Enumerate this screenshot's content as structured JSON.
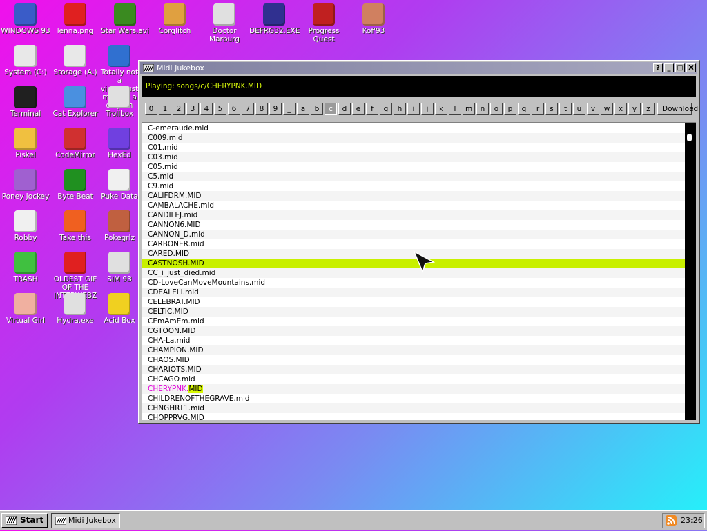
{
  "desktop": {
    "icons": [
      {
        "label": "WINDOWS 93",
        "icon": "computer-icon"
      },
      {
        "label": "lenna.png",
        "icon": "image-file-icon"
      },
      {
        "label": "Star Wars.avi",
        "icon": "yoda-icon"
      },
      {
        "label": "Corglitch",
        "icon": "corgi-icon"
      },
      {
        "label": "Doctor Marburg",
        "icon": "doctor-icon"
      },
      {
        "label": "DEFRG32.EXE",
        "icon": "defrag-icon"
      },
      {
        "label": "Progress Quest",
        "icon": "crossed-swords-icon"
      },
      {
        "label": "Kof'93",
        "icon": "fighter-icon"
      },
      {
        "label": "System (C:)",
        "icon": "drive-icon"
      },
      {
        "label": "Storage (A:)",
        "icon": "floppy-drive-icon"
      },
      {
        "label": "Totally not a virus.Trust me...im a dolphin",
        "icon": "dolphin-icon"
      },
      {
        "label": "Terminal",
        "icon": "terminal-icon"
      },
      {
        "label": "Cat Explorer",
        "icon": "cat-globe-icon"
      },
      {
        "label": "Trollbox",
        "icon": "trollbox-icon"
      },
      {
        "label": "Piskel",
        "icon": "palette-icon"
      },
      {
        "label": "CodeMirror",
        "icon": "codemirror-icon"
      },
      {
        "label": "HexEd",
        "icon": "hex-cube-icon"
      },
      {
        "label": "Poney Jockey",
        "icon": "pony-icon"
      },
      {
        "label": "Byte Beat",
        "icon": "bytebeat-icon"
      },
      {
        "label": "Puke Data",
        "icon": "pd-icon"
      },
      {
        "label": "Robby",
        "icon": "stick-figure-icon"
      },
      {
        "label": "Take this",
        "icon": "pixel-man-icon"
      },
      {
        "label": "Pokegrlz",
        "icon": "pokeball-icon"
      },
      {
        "label": "TRASH",
        "icon": "recycle-bin-icon"
      },
      {
        "label": "OLDEST GIF OF THE INTERWEBZ",
        "icon": "gif-file-icon"
      },
      {
        "label": "SIM 93",
        "icon": "sim-icon"
      },
      {
        "label": "Virtual Girl",
        "icon": "face-icon"
      },
      {
        "label": "Hydra.exe",
        "icon": "hydra-icon"
      },
      {
        "label": "Acid Box",
        "icon": "smiley-icon"
      }
    ]
  },
  "window": {
    "title": "Midi Jukebox",
    "status": "Playing: songs/c/CHERYPNK.MID",
    "letters": [
      "0",
      "1",
      "2",
      "3",
      "4",
      "5",
      "6",
      "7",
      "8",
      "9",
      "_",
      "a",
      "b",
      "c",
      "d",
      "e",
      "f",
      "g",
      "h",
      "i",
      "j",
      "k",
      "l",
      "m",
      "n",
      "o",
      "p",
      "q",
      "r",
      "s",
      "t",
      "u",
      "v",
      "w",
      "x",
      "y",
      "z"
    ],
    "active_letter": "c",
    "download_label": "Download",
    "buttons": {
      "help": "?",
      "minimize": "_",
      "maximize": "□",
      "close": "X"
    },
    "files": [
      "C-emeraude.mid",
      "C009.mid",
      "C01.mid",
      "C03.mid",
      "C05.mid",
      "C5.mid",
      "C9.mid",
      "CALIFDRM.MID",
      "CAMBALACHE.mid",
      "CANDILEJ.mid",
      "CANNON6.MID",
      "CANNON_D.mid",
      "CARBONER.mid",
      "CARED.MID",
      "CASTNOSH.MID",
      "CC_i_just_died.mid",
      "CD-LoveCanMoveMountains.mid",
      "CDEALELI.mid",
      "CELEBRAT.MID",
      "CELTIC.MID",
      "CEmAmEm.mid",
      "CGTOON.MID",
      "CHA-La.mid",
      "CHAMPION.MID",
      "CHAOS.MID",
      "CHARIOTS.MID",
      "CHCAGO.mid",
      "CHERYPNK.MID",
      "CHILDRENOFTHEGRAVE.mid",
      "CHNGHRT1.mid",
      "CHOPPRVG.MID"
    ],
    "selected_file": "CASTNOSH.MID",
    "playing_file": {
      "name": "CHERYPNK.",
      "ext": "MID"
    }
  },
  "taskbar": {
    "start_label": "Start",
    "task_label": "Midi Jukebox",
    "clock": "23:26",
    "tray_icon": "rss-icon"
  },
  "colors": {
    "selected_row": "#c8f000",
    "status_text": "#d4f40a",
    "playing_text": "#e000d8"
  }
}
